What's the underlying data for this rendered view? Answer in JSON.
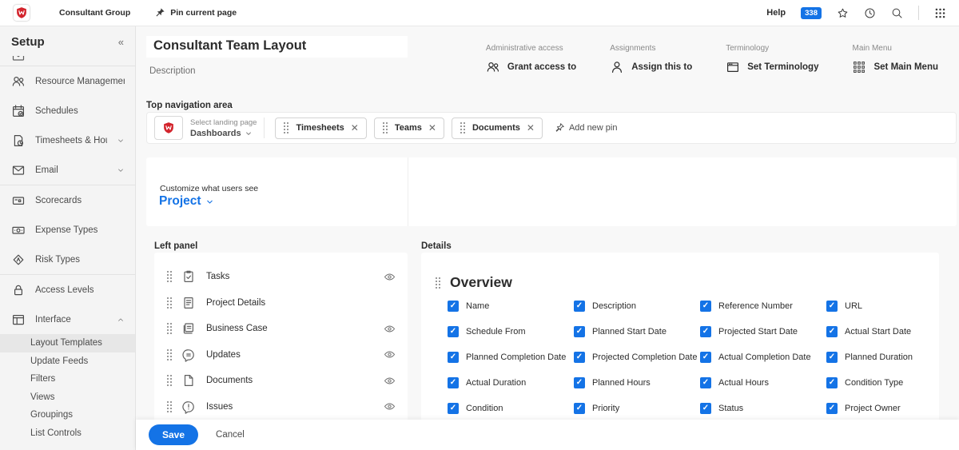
{
  "colors": {
    "accent_blue": "#1473e6",
    "brand_red": "#d3242c"
  },
  "topbar": {
    "logo_icon": "workfront-logo-icon",
    "account_name": "Consultant Group",
    "pin_label": "Pin current page",
    "help_label": "Help",
    "notification_count": "338",
    "right_icons": [
      "star-icon",
      "history-icon",
      "search-icon",
      "app-grid-icon"
    ]
  },
  "sidebar": {
    "title": "Setup",
    "collapse_icon": "double-chevron-left-icon",
    "items": [
      {
        "label": "Resource Management",
        "icon": "users-icon",
        "expandable": false,
        "divider_after": false
      },
      {
        "label": "Schedules",
        "icon": "calendar-icon",
        "expandable": false,
        "divider_after": false
      },
      {
        "label": "Timesheets & Hours",
        "icon": "timesheet-icon",
        "expandable": true,
        "divider_after": false
      },
      {
        "label": "Email",
        "icon": "envelope-icon",
        "expandable": true,
        "divider_after": true
      },
      {
        "label": "Scorecards",
        "icon": "scorecard-icon",
        "expandable": false,
        "divider_after": false
      },
      {
        "label": "Expense Types",
        "icon": "money-icon",
        "expandable": false,
        "divider_after": false
      },
      {
        "label": "Risk Types",
        "icon": "risk-icon",
        "expandable": false,
        "divider_after": true
      },
      {
        "label": "Access Levels",
        "icon": "lock-icon",
        "expandable": false,
        "divider_after": false
      },
      {
        "label": "Interface",
        "icon": "interface-icon",
        "expandable": false,
        "expanded": true,
        "divider_after": false
      }
    ],
    "interface_subitems": [
      {
        "label": "Layout Templates",
        "selected": true
      },
      {
        "label": "Update Feeds",
        "selected": false
      },
      {
        "label": "Filters",
        "selected": false
      },
      {
        "label": "Views",
        "selected": false
      },
      {
        "label": "Groupings",
        "selected": false
      },
      {
        "label": "List Controls",
        "selected": false
      }
    ]
  },
  "header": {
    "title_value": "Consultant Team Layout",
    "description_placeholder": "Description",
    "actions": [
      {
        "group": "Administrative access",
        "label": "Grant access to",
        "icon": "users-icon"
      },
      {
        "group": "Assignments",
        "label": "Assign this to",
        "icon": "user-icon"
      },
      {
        "group": "Terminology",
        "label": "Set Terminology",
        "icon": "terminology-window-icon"
      },
      {
        "group": "Main Menu",
        "label": "Set Main Menu",
        "icon": "menu-grid-icon"
      }
    ]
  },
  "top_navigation": {
    "section_label": "Top navigation area",
    "logo_icon": "workfront-logo-icon",
    "landing_page_label": "Select landing page",
    "landing_page_value": "Dashboards",
    "pins": [
      {
        "label": "Timesheets"
      },
      {
        "label": "Teams"
      },
      {
        "label": "Documents"
      }
    ],
    "add_pin_label": "Add new pin",
    "add_pin_icon": "add-pin-icon"
  },
  "customize": {
    "label": "Customize what users see",
    "value": "Project"
  },
  "left_panel": {
    "section_label": "Left panel",
    "items": [
      {
        "label": "Tasks",
        "icon": "tasks-icon",
        "eye": true
      },
      {
        "label": "Project Details",
        "icon": "project-details-icon",
        "eye": false
      },
      {
        "label": "Business Case",
        "icon": "business-case-icon",
        "eye": true
      },
      {
        "label": "Updates",
        "icon": "updates-icon",
        "eye": true
      },
      {
        "label": "Documents",
        "icon": "document-icon",
        "eye": true
      },
      {
        "label": "Issues",
        "icon": "issues-icon",
        "eye": true
      }
    ]
  },
  "details": {
    "section_label": "Details",
    "card_title": "Overview",
    "fields": [
      {
        "label": "Name",
        "checked": true
      },
      {
        "label": "Description",
        "checked": true
      },
      {
        "label": "Reference Number",
        "checked": true
      },
      {
        "label": "URL",
        "checked": true
      },
      {
        "label": "Schedule From",
        "checked": true
      },
      {
        "label": "Planned Start Date",
        "checked": true
      },
      {
        "label": "Projected Start Date",
        "checked": true
      },
      {
        "label": "Actual Start Date",
        "checked": true
      },
      {
        "label": "Planned Completion Date",
        "checked": true
      },
      {
        "label": "Projected Completion Date",
        "checked": true
      },
      {
        "label": "Actual Completion Date",
        "checked": true
      },
      {
        "label": "Planned Duration",
        "checked": true
      },
      {
        "label": "Actual Duration",
        "checked": true
      },
      {
        "label": "Planned Hours",
        "checked": true
      },
      {
        "label": "Actual Hours",
        "checked": true
      },
      {
        "label": "Condition Type",
        "checked": true
      },
      {
        "label": "Condition",
        "checked": true
      },
      {
        "label": "Priority",
        "checked": true
      },
      {
        "label": "Status",
        "checked": true
      },
      {
        "label": "Project Owner",
        "checked": true
      }
    ]
  },
  "footer": {
    "save_label": "Save",
    "cancel_label": "Cancel"
  }
}
